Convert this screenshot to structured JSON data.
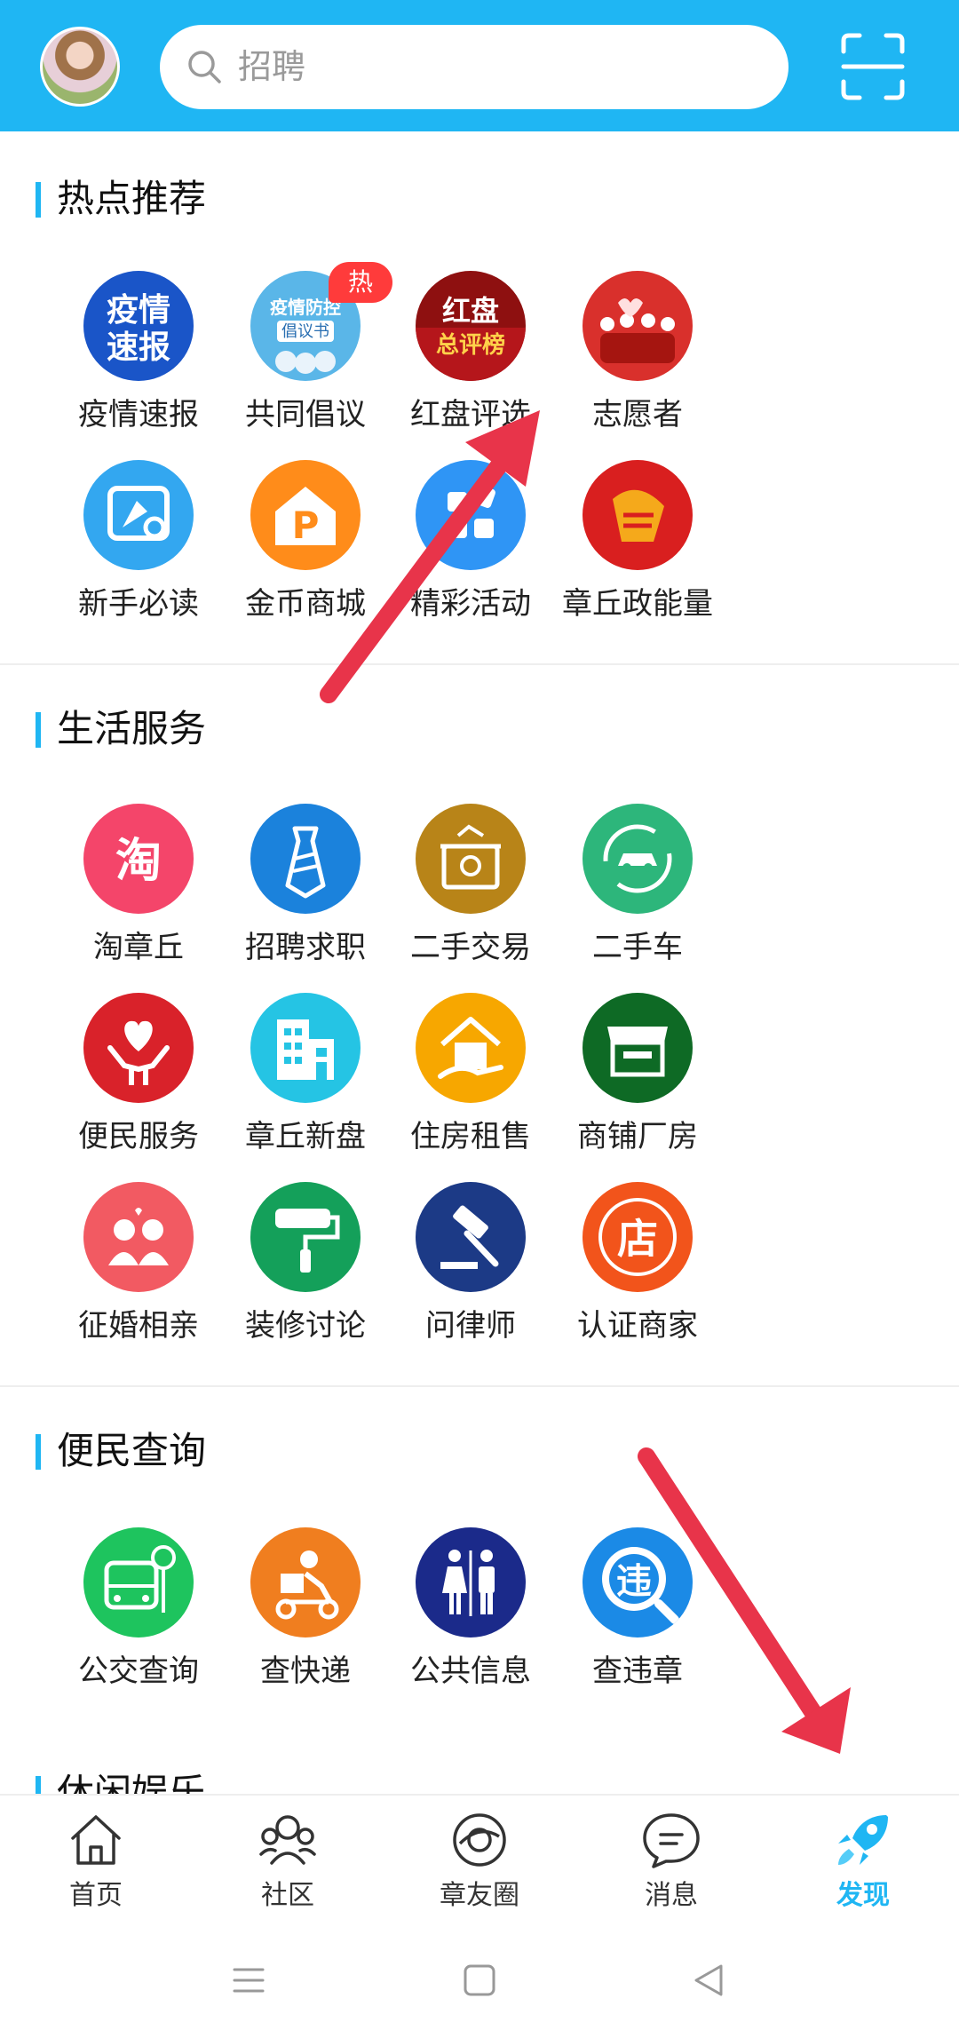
{
  "header": {
    "search_placeholder": "招聘"
  },
  "sections": [
    {
      "title": "热点推荐",
      "items": [
        {
          "label": "疫情速报",
          "icon": "epidemic-report-icon",
          "badge": "",
          "glyph": "疫情\n速报",
          "color": "#1a55c8"
        },
        {
          "label": "共同倡议",
          "icon": "joint-initiative-icon",
          "badge": "热",
          "glyph": "疫情防控\n倡议书",
          "color": "#5ab6e8"
        },
        {
          "label": "红盘评选",
          "icon": "red-disk-ranking-icon",
          "badge": "",
          "glyph": "红盘\n总评榜",
          "color": "#8e1010"
        },
        {
          "label": "志愿者",
          "icon": "volunteer-icon",
          "badge": "",
          "glyph": "",
          "color": "#d9302c"
        },
        {
          "label": "新手必读",
          "icon": "newbie-guide-icon",
          "badge": "",
          "glyph": "",
          "color": "#33a7f0"
        },
        {
          "label": "金币商城",
          "icon": "coin-mall-icon",
          "badge": "",
          "glyph": "P",
          "color": "#ff8c1a"
        },
        {
          "label": "精彩活动",
          "icon": "activities-icon",
          "badge": "",
          "glyph": "",
          "color": "#2f95f5"
        },
        {
          "label": "章丘政能量",
          "icon": "zhangqiu-energy-icon",
          "badge": "",
          "glyph": "",
          "color": "#d91f1f"
        }
      ]
    },
    {
      "title": "生活服务",
      "items": [
        {
          "label": "淘章丘",
          "icon": "taobao-zhangqiu-icon",
          "badge": "",
          "glyph": "淘",
          "color": "#f4456a"
        },
        {
          "label": "招聘求职",
          "icon": "job-tie-icon",
          "badge": "",
          "glyph": "",
          "color": "#1b82dc"
        },
        {
          "label": "二手交易",
          "icon": "second-hand-box-icon",
          "badge": "",
          "glyph": "",
          "color": "#b88418"
        },
        {
          "label": "二手车",
          "icon": "used-car-icon",
          "badge": "",
          "glyph": "",
          "color": "#2db67b"
        },
        {
          "label": "便民服务",
          "icon": "heart-hands-icon",
          "badge": "",
          "glyph": "",
          "color": "#d9222a"
        },
        {
          "label": "章丘新盘",
          "icon": "building-icon",
          "badge": "",
          "glyph": "",
          "color": "#25c4e4"
        },
        {
          "label": "住房租售",
          "icon": "house-hand-icon",
          "badge": "",
          "glyph": "",
          "color": "#f7a700"
        },
        {
          "label": "商铺厂房",
          "icon": "shop-awning-icon",
          "badge": "",
          "glyph": "",
          "color": "#0e6a25"
        },
        {
          "label": "征婚相亲",
          "icon": "couple-icon",
          "badge": "",
          "glyph": "",
          "color": "#f25a62"
        },
        {
          "label": "装修讨论",
          "icon": "paint-roller-icon",
          "badge": "",
          "glyph": "",
          "color": "#14a05a"
        },
        {
          "label": "问律师",
          "icon": "gavel-icon",
          "badge": "",
          "glyph": "",
          "color": "#1c3a86"
        },
        {
          "label": "认证商家",
          "icon": "certified-shop-icon",
          "badge": "",
          "glyph": "店",
          "color": "#f2541b"
        }
      ]
    },
    {
      "title": "便民查询",
      "items": [
        {
          "label": "公交查询",
          "icon": "bus-icon",
          "badge": "",
          "glyph": "",
          "color": "#1ec45e"
        },
        {
          "label": "查快递",
          "icon": "courier-icon",
          "badge": "",
          "glyph": "",
          "color": "#f07e1f"
        },
        {
          "label": "公共信息",
          "icon": "restroom-icon",
          "badge": "",
          "glyph": "",
          "color": "#1b2a8a"
        },
        {
          "label": "查违章",
          "icon": "traffic-violation-icon",
          "badge": "",
          "glyph": "违",
          "color": "#1b8ae6"
        }
      ]
    },
    {
      "title": "休闲娱乐",
      "items": []
    }
  ],
  "bottom_nav": [
    {
      "label": "首页",
      "icon": "home-icon",
      "active": false
    },
    {
      "label": "社区",
      "icon": "community-icon",
      "active": false
    },
    {
      "label": "章友圈",
      "icon": "friends-circle-icon",
      "active": false
    },
    {
      "label": "消息",
      "icon": "message-icon",
      "active": false
    },
    {
      "label": "发现",
      "icon": "discover-rocket-icon",
      "active": true
    }
  ],
  "colors": {
    "primary": "#1fb6f3",
    "arrow": "#e8344a"
  }
}
